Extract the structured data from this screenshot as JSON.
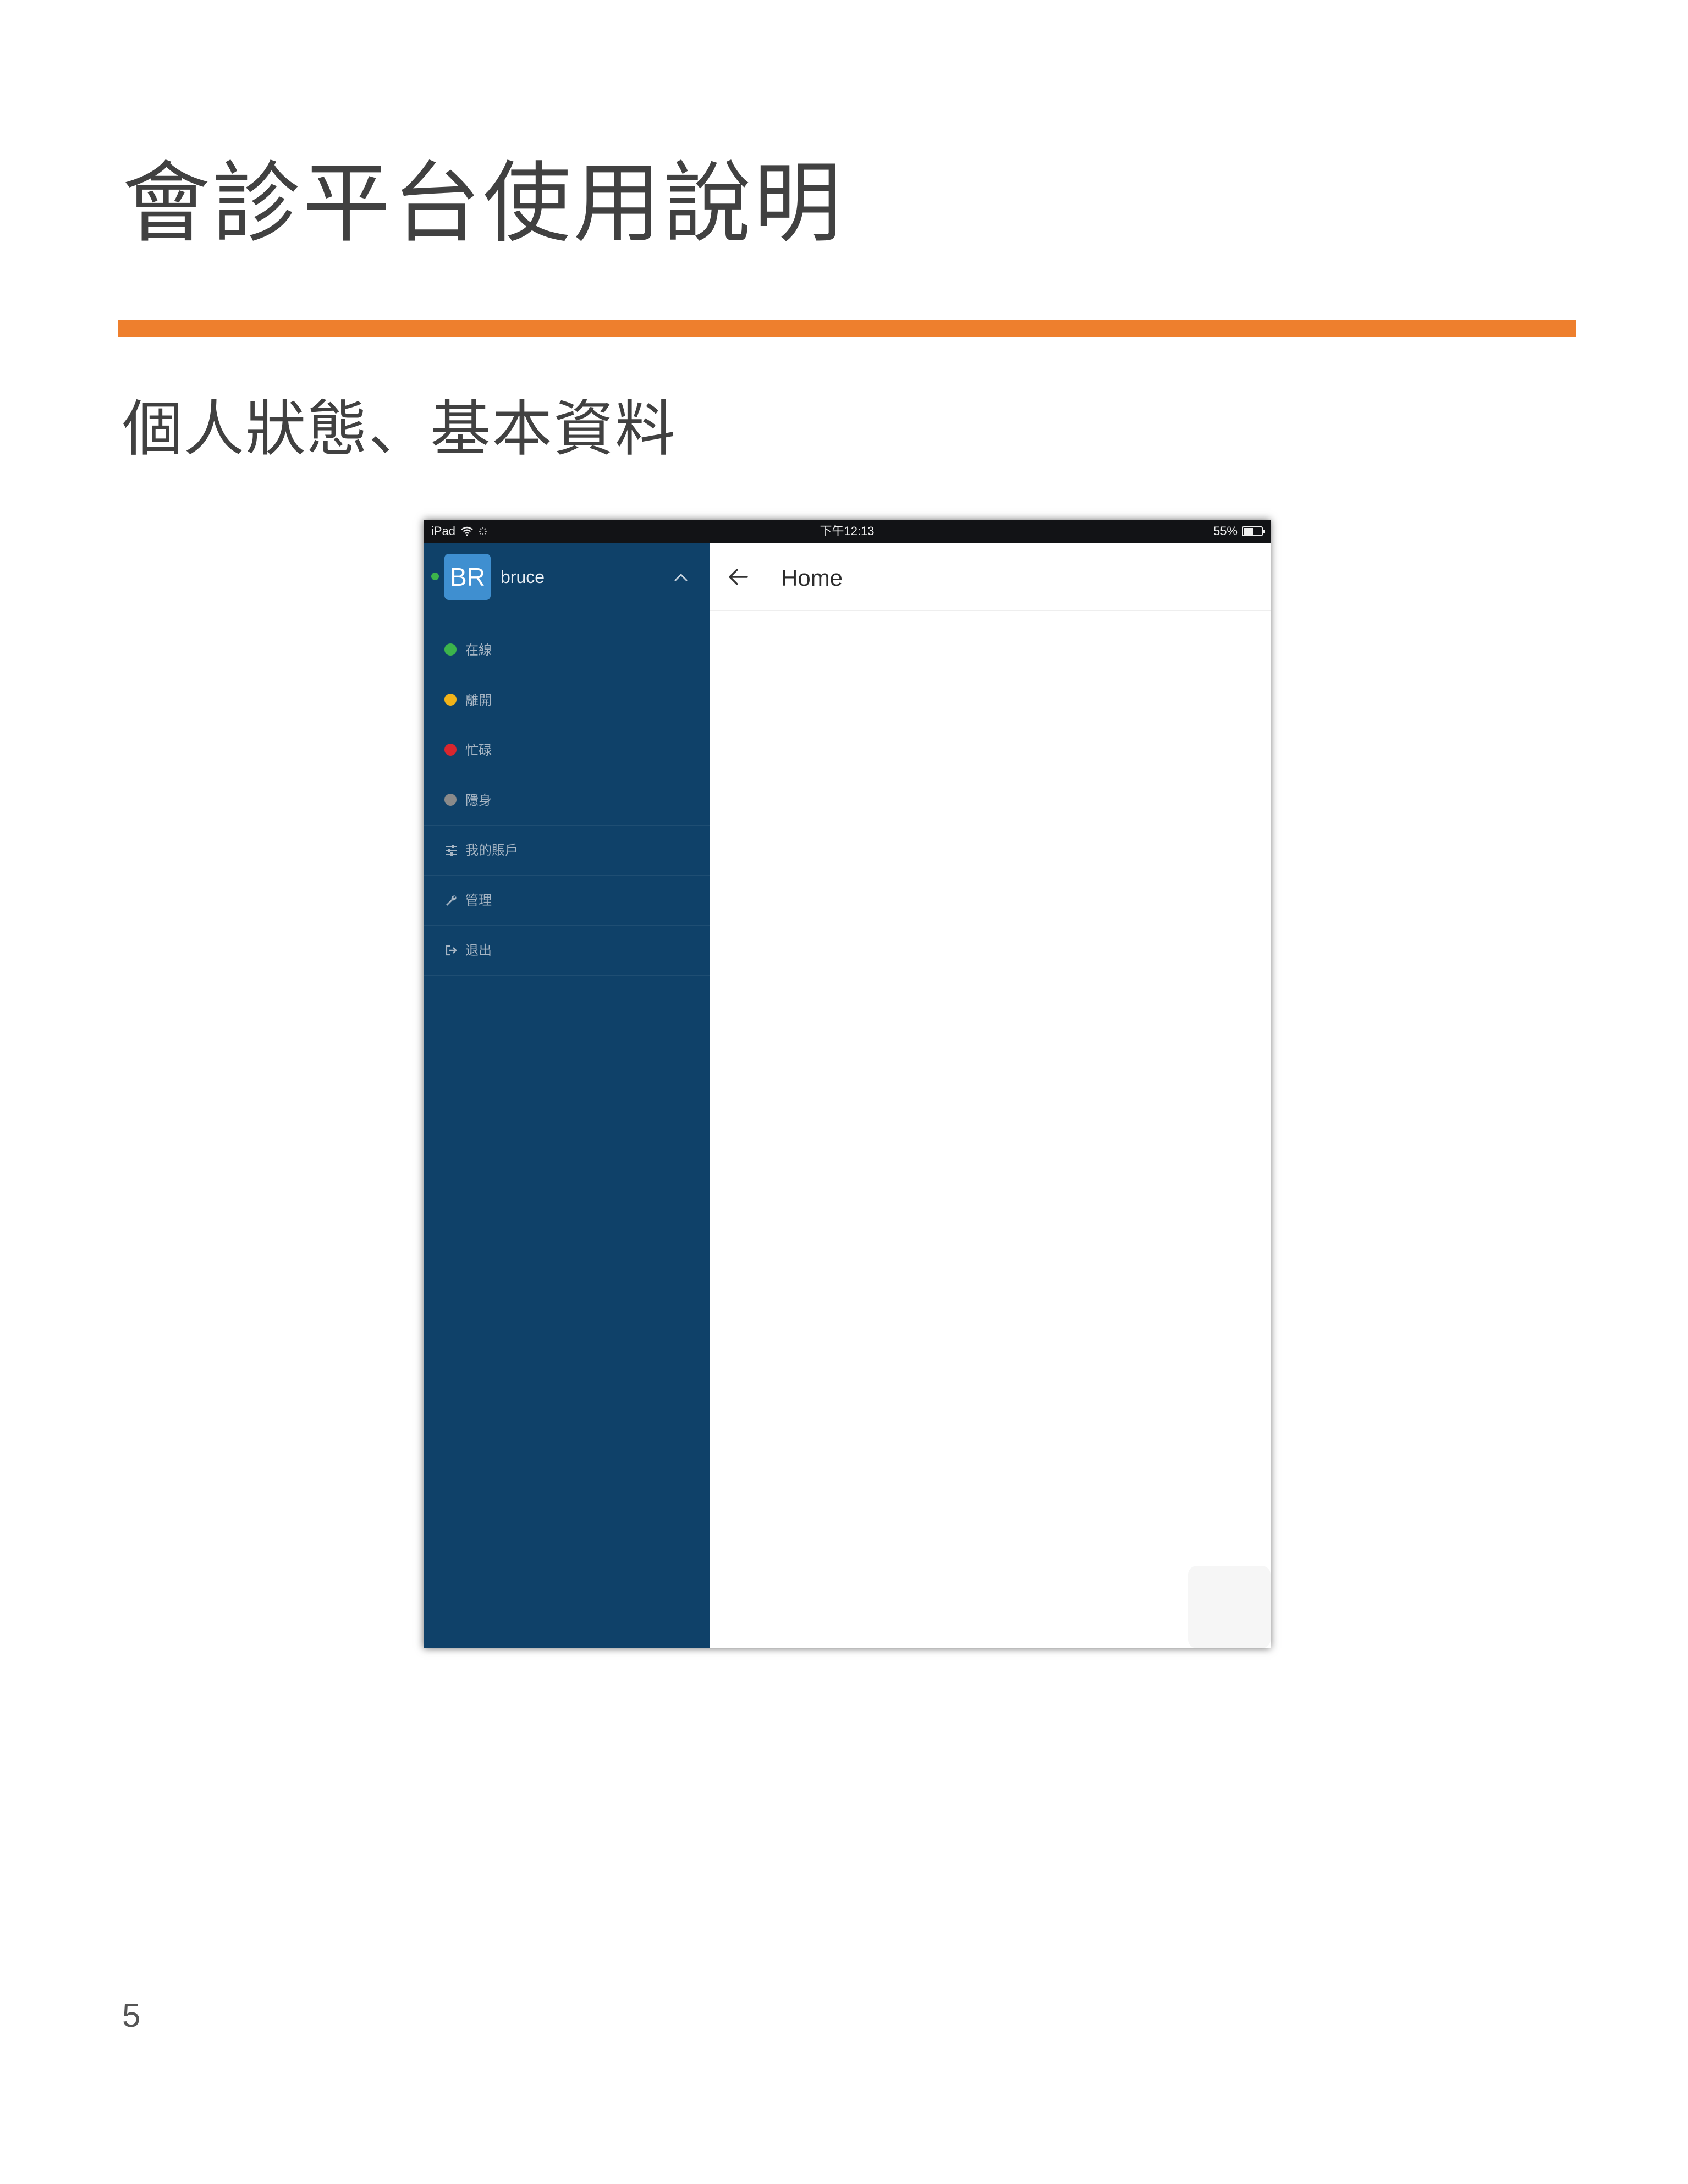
{
  "document": {
    "title": "會診平台使用說明",
    "section_title": "個人狀態、基本資料",
    "page_number": "5",
    "accent_color": "#ee7f2d"
  },
  "status_bar": {
    "device": "iPad",
    "time": "下午12:13",
    "battery": "55%",
    "battery_level": 0.55,
    "icons": [
      "wifi-icon",
      "activity-spinner-icon",
      "battery-icon"
    ]
  },
  "sidebar": {
    "background": "#0f4169",
    "avatar_initials": "BR",
    "avatar_color": "#3f8fd0",
    "username": "bruce",
    "presence_color": "#3cb44b",
    "menu": [
      {
        "label": "在線",
        "icon": "green-dot-icon",
        "color": "#3cb44b"
      },
      {
        "label": "離開",
        "icon": "yellow-dot-icon",
        "color": "#f2b319"
      },
      {
        "label": "忙碌",
        "icon": "red-dot-icon",
        "color": "#d9262e"
      },
      {
        "label": "隱身",
        "icon": "gray-dot-icon",
        "color": "#8a8a8a"
      },
      {
        "label": "我的賬戶",
        "icon": "sliders-icon"
      },
      {
        "label": "管理",
        "icon": "wrench-icon"
      },
      {
        "label": "退出",
        "icon": "logout-icon"
      }
    ]
  },
  "content": {
    "appbar_title": "Home",
    "back_icon": "back-arrow-icon"
  }
}
